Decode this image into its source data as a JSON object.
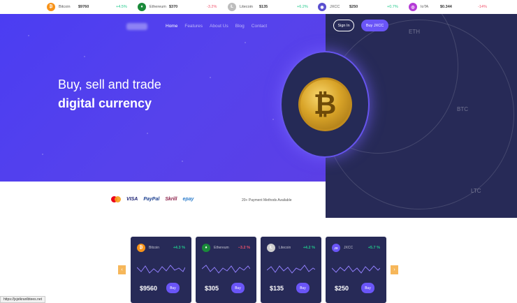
{
  "ticker": [
    {
      "name": "Bitcoin",
      "price": "$9760",
      "change": "+4.5%",
      "dir": "up",
      "icon": "bitcoin-icon",
      "glyph": "₿",
      "color": "#f7931a"
    },
    {
      "name": "Ethereum",
      "price": "$370",
      "change": "-3.2%",
      "dir": "down",
      "icon": "ethereum-icon",
      "glyph": "♦",
      "color": "#1a8a3a"
    },
    {
      "name": "Litecoin",
      "price": "$135",
      "change": "+6.2%",
      "dir": "up",
      "icon": "litecoin-icon",
      "glyph": "Ł",
      "color": "#bdbdbd"
    },
    {
      "name": "JXCC",
      "price": "$250",
      "change": "+0.7%",
      "dir": "up",
      "icon": "jxcc-icon",
      "glyph": "◉",
      "color": "#5a4fcf"
    },
    {
      "name": "IoTA",
      "price": "$0.344",
      "change": "-14%",
      "dir": "down",
      "icon": "iota-icon",
      "glyph": "◎",
      "color": "#b43bd6"
    }
  ],
  "nav": {
    "logo": "JXCC",
    "items": [
      "Home",
      "Features",
      "About Us",
      "Blog",
      "Contact"
    ],
    "active": "Home",
    "signin": "Sign In",
    "buy": "Buy JXCC"
  },
  "hero": {
    "line1": "Buy, sell and trade",
    "line2": "digital currency",
    "coin_glyph": "₿"
  },
  "rings": {
    "labels": [
      "ETH",
      "BTC",
      "LTC"
    ]
  },
  "payments": {
    "brands": [
      "VISA",
      "PayPal",
      "Skrill",
      "epay"
    ],
    "note": "20+ Payment Methods Available"
  },
  "cards": [
    {
      "name": "Bitcoin",
      "change": "+4.3 %",
      "dir": "up",
      "price": "$9560",
      "buy": "Buy",
      "icon": "bitcoin-icon",
      "glyph": "₿",
      "color": "#f7931a"
    },
    {
      "name": "Ethereum",
      "change": "−3.2 %",
      "dir": "down",
      "price": "$305",
      "buy": "Buy",
      "icon": "ethereum-icon",
      "glyph": "♦",
      "color": "#1a8a3a"
    },
    {
      "name": "Litecoin",
      "change": "+4.2 %",
      "dir": "up",
      "price": "$135",
      "buy": "Buy",
      "icon": "litecoin-icon",
      "glyph": "Ł",
      "color": "#cfcfcf"
    },
    {
      "name": "JXCC",
      "change": "+5.7 %",
      "dir": "up",
      "price": "$250",
      "buy": "Buy",
      "icon": "jxcc-icon",
      "glyph": "JX",
      "color": "#6a55f7"
    }
  ],
  "arrows": {
    "prev": "‹",
    "next": "›"
  },
  "status_url": "https://jxjstkranlbtees.net",
  "colors": {
    "accent": "#6a55f7",
    "hero": "#4b3df2",
    "dark": "#272a57",
    "up": "#21c98b",
    "down": "#f1526b",
    "arrow": "#f6b75a"
  }
}
